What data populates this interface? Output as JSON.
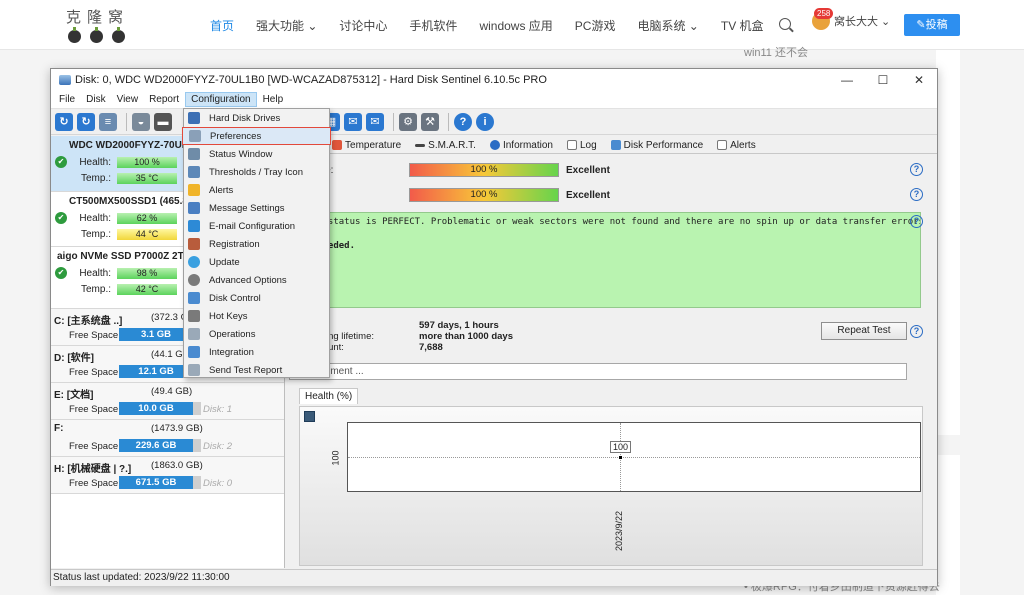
{
  "site": {
    "logo_text": "克隆窝",
    "nav": [
      "首页",
      "强大功能 ⌄",
      "讨论中心",
      "手机软件",
      "windows 应用",
      "PC游戏",
      "电脑系统 ⌄",
      "TV 机盒"
    ],
    "notif_count": "258",
    "user_name": "窝长大大 ⌄",
    "post_button": "✎投稿",
    "side_text_top": "win11 还不会",
    "side_text_bottom": "• 极爆RPG：付着乡田制造下资源赶得去"
  },
  "window": {
    "title": "Disk: 0, WDC WD2000FYYZ-70UL1B0 [WD-WCAZAD875312]  -  Hard Disk Sentinel 6.10.5c PRO",
    "controls": [
      "—",
      "☐",
      "✕"
    ],
    "menu": [
      "File",
      "Disk",
      "View",
      "Report",
      "Configuration",
      "Help"
    ]
  },
  "dropdown": [
    {
      "label": "Hard Disk Drives",
      "color": "#3c6fb4"
    },
    {
      "label": "Preferences",
      "color": "#8aa0b8"
    },
    {
      "label": "Status Window",
      "color": "#6f8ca8"
    },
    {
      "label": "Thresholds / Tray Icon",
      "color": "#5d88b8"
    },
    {
      "label": "Alerts",
      "color": "#f0b429"
    },
    {
      "label": "Message Settings",
      "color": "#4a7fc2"
    },
    {
      "label": "E-mail Configuration",
      "color": "#2d8ad6"
    },
    {
      "label": "Registration",
      "color": "#b85c3c"
    },
    {
      "label": "Update",
      "color": "#3aa0e0"
    },
    {
      "label": "Advanced Options",
      "color": "#7a7a7a"
    },
    {
      "label": "Disk Control",
      "color": "#4a8bd0"
    },
    {
      "label": "Hot Keys",
      "color": "#7a7a7a"
    },
    {
      "label": "Operations",
      "color": "#9aa9b8"
    },
    {
      "label": "Integration",
      "color": "#4a8bd0"
    },
    {
      "label": "Send Test Report",
      "color": "#9aa9b8"
    }
  ],
  "disks": [
    {
      "name": "WDC WD2000FYYZ-70UL",
      "health_label": "Health:",
      "health": "100 %",
      "temp_label": "Temp.:",
      "temp": "35 °C"
    },
    {
      "name": "CT500MX500SSD1 (465.8",
      "health_label": "Health:",
      "health": "62 %",
      "temp_label": "Temp.:",
      "temp": "44 °C"
    },
    {
      "name": "aigo NVMe SSD P7000Z 2T",
      "health_label": "Health:",
      "health": "98 %",
      "temp_label": "Temp.:",
      "temp": "42 °C"
    }
  ],
  "volumes": [
    {
      "name": "C: [主系统盘 ..]",
      "size": "(372.3 G",
      "free_label": "Free Space",
      "free": "3.1 GB",
      "disk": ""
    },
    {
      "name": "D: [软件]",
      "size": "(44.1 G",
      "free_label": "Free Space",
      "free": "12.1 GB",
      "disk": ""
    },
    {
      "name": "E: [文档]",
      "size": "(49.4 GB)",
      "free_label": "Free Space",
      "free": "10.0 GB",
      "disk": "Disk: 1"
    },
    {
      "name": "F:",
      "size": "(1473.9 GB)",
      "free_label": "Free Space",
      "free": "229.6 GB",
      "disk": "Disk: 2"
    },
    {
      "name": "H: [机械硬盘 | ?.]",
      "size": "(1863.0 GB)",
      "free_label": "Free Space",
      "free": "671.5 GB",
      "disk": "Disk: 0"
    }
  ],
  "tabs": [
    "view",
    "Temperature",
    "S.M.A.R.T.",
    "Information",
    "Log",
    "Disk Performance",
    "Alerts"
  ],
  "performance": {
    "label": "formance:",
    "value": "100 %",
    "status": "Excellent"
  },
  "health": {
    "label": "lth:",
    "value": "100 %",
    "status": "Excellent"
  },
  "status_text": [
    "d disk status is PERFECT. Problematic or weak sectors were not found and there are no spin up or data transfer errors.",
    "ions needed."
  ],
  "info": [
    {
      "label": "n time:",
      "value": "597 days, 1 hours"
    },
    {
      "label": "d remaining lifetime:",
      "value": "more than 1000 days"
    },
    {
      "label": "rt/stop count:",
      "value": "7,688"
    }
  ],
  "repeat_test": "Repeat Test",
  "comment_placeholder": "add comment ...",
  "chart_data": {
    "type": "line",
    "title": "Health (%)",
    "x": [
      "2023/9/22"
    ],
    "series": [
      {
        "values": [
          100
        ]
      }
    ],
    "ylabel": "",
    "yticks": [
      "100"
    ]
  },
  "status_bar": "Status last updated: 2023/9/22 11:30:00"
}
